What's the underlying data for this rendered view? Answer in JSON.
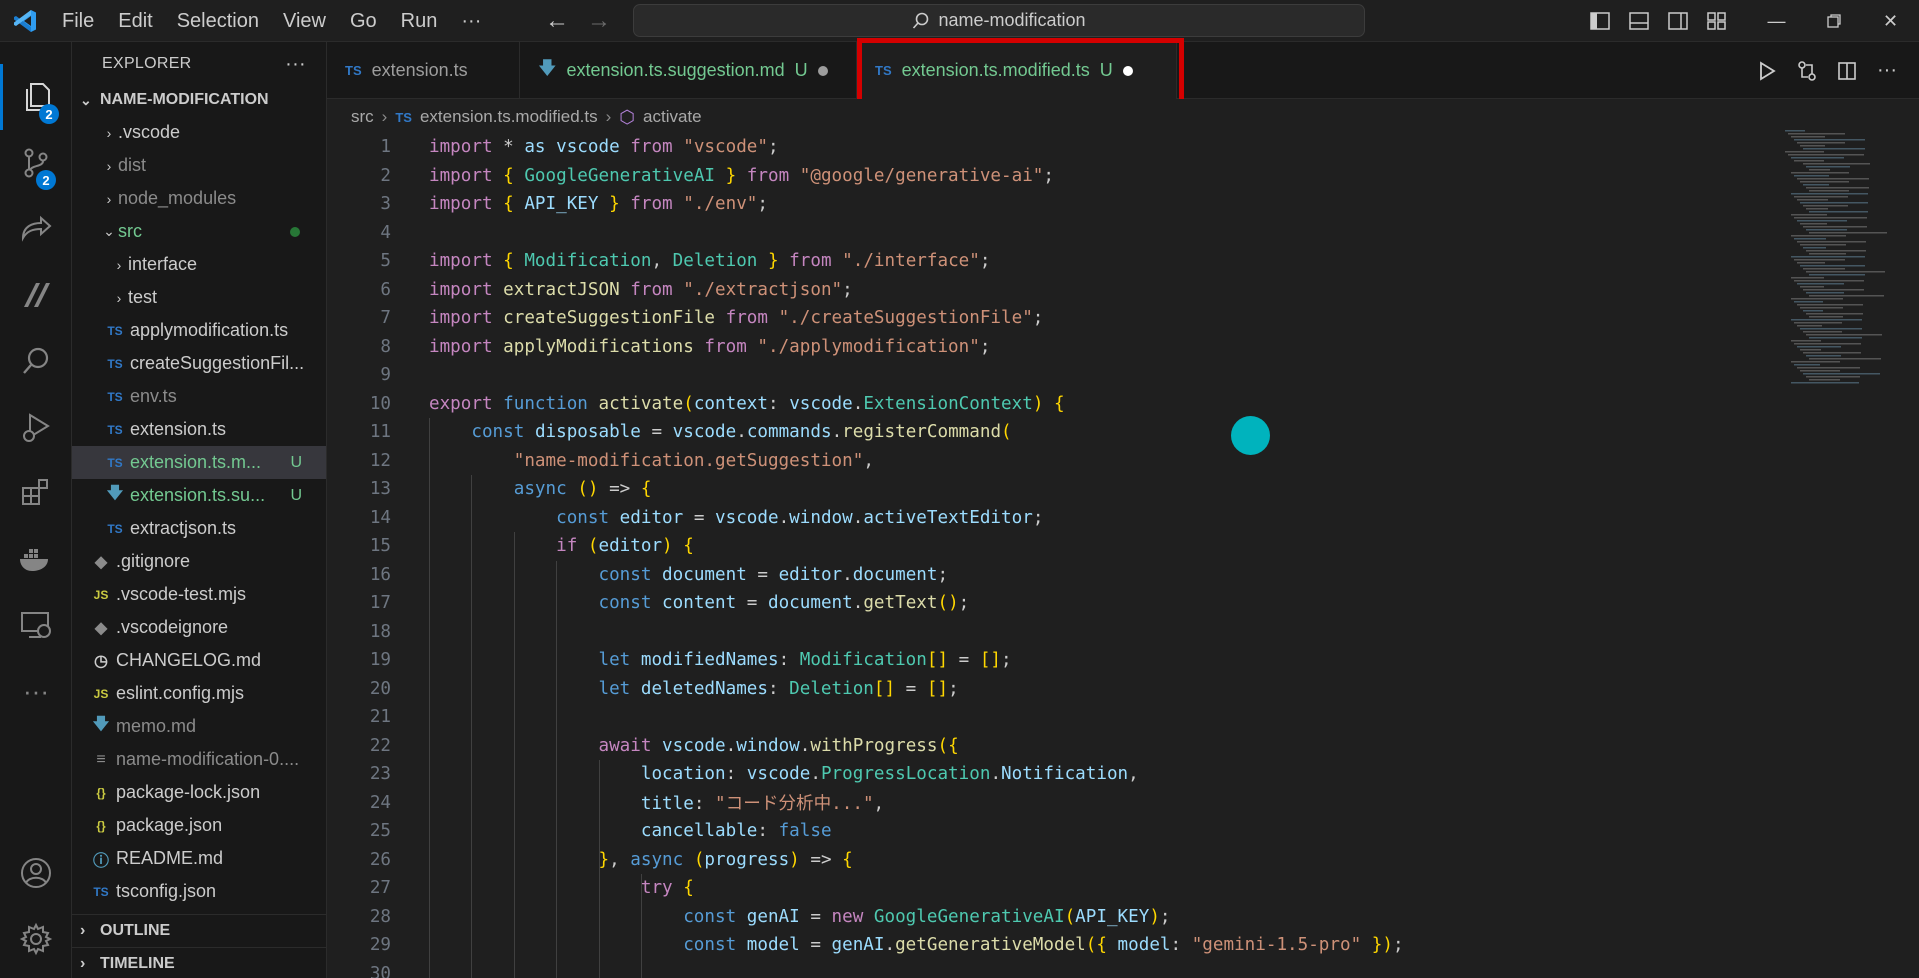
{
  "titlebar": {
    "menus": [
      "File",
      "Edit",
      "Selection",
      "View",
      "Go",
      "Run",
      "···"
    ],
    "search_text": "name-modification"
  },
  "activity": {
    "explorer_badge": "2",
    "scm_badge": "2"
  },
  "explorer": {
    "title": "EXPLORER",
    "more": "···",
    "section": "NAME-MODIFICATION",
    "items": [
      {
        "label": ".vscode"
      },
      {
        "label": "dist"
      },
      {
        "label": "node_modules"
      },
      {
        "label": "src"
      },
      {
        "label": "interface"
      },
      {
        "label": "test"
      },
      {
        "label": "applymodification.ts",
        "icon": "TS"
      },
      {
        "label": "createSuggestionFil...",
        "icon": "TS"
      },
      {
        "label": "env.ts",
        "icon": "TS"
      },
      {
        "label": "extension.ts",
        "icon": "TS"
      },
      {
        "label": "extension.ts.m...",
        "icon": "TS",
        "git": "U"
      },
      {
        "label": "extension.ts.su...",
        "git": "U"
      },
      {
        "label": "extractjson.ts",
        "icon": "TS"
      },
      {
        "label": ".gitignore"
      },
      {
        "label": ".vscode-test.mjs",
        "icon": "JS"
      },
      {
        "label": ".vscodeignore"
      },
      {
        "label": "CHANGELOG.md"
      },
      {
        "label": "eslint.config.mjs",
        "icon": "JS"
      },
      {
        "label": "memo.md"
      },
      {
        "label": "name-modification-0...."
      },
      {
        "label": "package-lock.json",
        "icon": "{}"
      },
      {
        "label": "package.json",
        "icon": "{}"
      },
      {
        "label": "README.md"
      },
      {
        "label": "tsconfig.json",
        "icon": "TS"
      }
    ],
    "outline": "OUTLINE",
    "timeline": "TIMELINE"
  },
  "tabs": [
    {
      "icon": "TS",
      "label": "extension.ts"
    },
    {
      "label": "extension.ts.suggestion.md",
      "status": "U"
    },
    {
      "icon": "TS",
      "label": "extension.ts.modified.ts",
      "status": "U"
    }
  ],
  "breadcrumb": {
    "folder": "src",
    "file_icon": "TS",
    "file": "extension.ts.modified.ts",
    "symbol": "activate"
  },
  "editor": {
    "line_numbers": [
      "1",
      "2",
      "3",
      "4",
      "5",
      "6",
      "7",
      "8",
      "9",
      "10",
      "11",
      "12",
      "13",
      "14",
      "15",
      "16",
      "17",
      "18",
      "19",
      "20",
      "21",
      "22",
      "23",
      "24",
      "25",
      "26",
      "27",
      "28",
      "29",
      "30"
    ],
    "lines": [
      "import * as vscode from \"vscode\";",
      "import { GoogleGenerativeAI } from \"@google/generative-ai\";",
      "import { API_KEY } from \"./env\";",
      "",
      "import { Modification, Deletion } from \"./interface\";",
      "import extractJSON from \"./extractjson\";",
      "import createSuggestionFile from \"./createSuggestionFile\";",
      "import applyModifications from \"./applymodification\";",
      "",
      "export function activate(context: vscode.ExtensionContext) {",
      "    const disposable = vscode.commands.registerCommand(",
      "        \"name-modification.getSuggestion\",",
      "        async () => {",
      "            const editor = vscode.window.activeTextEditor;",
      "            if (editor) {",
      "                const document = editor.document;",
      "                const content = document.getText();",
      "",
      "                let modifiedNames: Modification[] = [];",
      "                let deletedNames: Deletion[] = [];",
      "",
      "                await vscode.window.withProgress({",
      "                    location: vscode.ProgressLocation.Notification,",
      "                    title: \"コード分析中...\",",
      "                    cancellable: false",
      "                }, async (progress) => {",
      "                    try {",
      "                        const genAI = new GoogleGenerativeAI(API_KEY);",
      "                        const model = genAI.getGenerativeModel({ model: \"gemini-1.5-pro\" });",
      ""
    ]
  }
}
